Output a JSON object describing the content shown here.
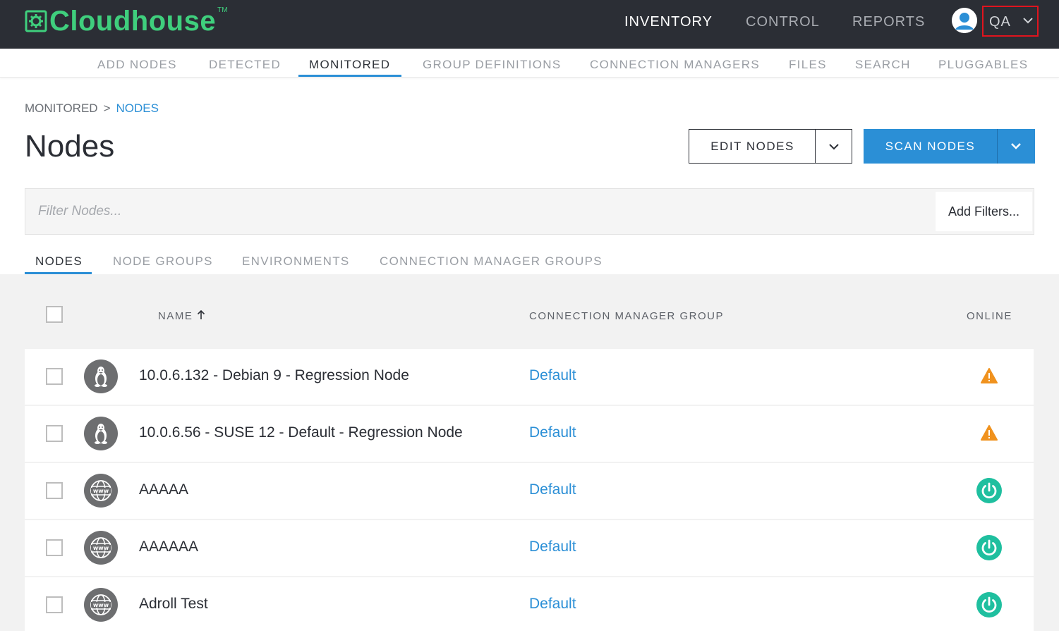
{
  "header": {
    "brand": "Cloudhouse",
    "trademark": "TM",
    "nav": [
      {
        "label": "INVENTORY",
        "active": true
      },
      {
        "label": "CONTROL",
        "active": false
      },
      {
        "label": "REPORTS",
        "active": false
      }
    ],
    "user_menu": {
      "label": "QA",
      "icon": "user-avatar-icon"
    }
  },
  "subnav": {
    "items": [
      {
        "label": "ADD NODES",
        "active": false
      },
      {
        "label": "DETECTED",
        "active": false
      },
      {
        "label": "MONITORED",
        "active": true
      },
      {
        "label": "GROUP DEFINITIONS",
        "active": false
      },
      {
        "label": "CONNECTION MANAGERS",
        "active": false
      },
      {
        "label": "FILES",
        "active": false
      },
      {
        "label": "SEARCH",
        "active": false
      },
      {
        "label": "PLUGGABLES",
        "active": false
      }
    ]
  },
  "breadcrumb": {
    "parent": "MONITORED",
    "separator": ">",
    "current": "NODES"
  },
  "page": {
    "title": "Nodes"
  },
  "actions": {
    "edit_label": "EDIT NODES",
    "scan_label": "SCAN NODES"
  },
  "filter": {
    "placeholder": "Filter Nodes...",
    "add_filters_label": "Add Filters..."
  },
  "tabs": [
    {
      "label": "NODES",
      "active": true
    },
    {
      "label": "NODE GROUPS",
      "active": false
    },
    {
      "label": "ENVIRONMENTS",
      "active": false
    },
    {
      "label": "CONNECTION MANAGER GROUPS",
      "active": false
    }
  ],
  "table": {
    "columns": {
      "name": "NAME",
      "group": "CONNECTION MANAGER GROUP",
      "online": "ONLINE"
    },
    "sort": {
      "column": "NAME",
      "direction": "ascending"
    },
    "rows": [
      {
        "name": "10.0.6.132 - Debian 9 - Regression Node",
        "group": "Default",
        "os_icon": "linux-icon",
        "status": "warning"
      },
      {
        "name": "10.0.6.56 - SUSE 12 - Default - Regression Node",
        "group": "Default",
        "os_icon": "linux-icon",
        "status": "warning"
      },
      {
        "name": "AAAAA",
        "group": "Default",
        "os_icon": "www-globe-icon",
        "status": "online"
      },
      {
        "name": "AAAAAA",
        "group": "Default",
        "os_icon": "www-globe-icon",
        "status": "online"
      },
      {
        "name": "Adroll Test",
        "group": "Default",
        "os_icon": "www-globe-icon",
        "status": "online"
      }
    ]
  },
  "colors": {
    "topbar": "#2b2e35",
    "brand": "#3fcf7d",
    "accent": "#2b8fd6",
    "warning": "#f0921e",
    "online": "#1fbf9f",
    "highlight_box": "#e0141e"
  }
}
